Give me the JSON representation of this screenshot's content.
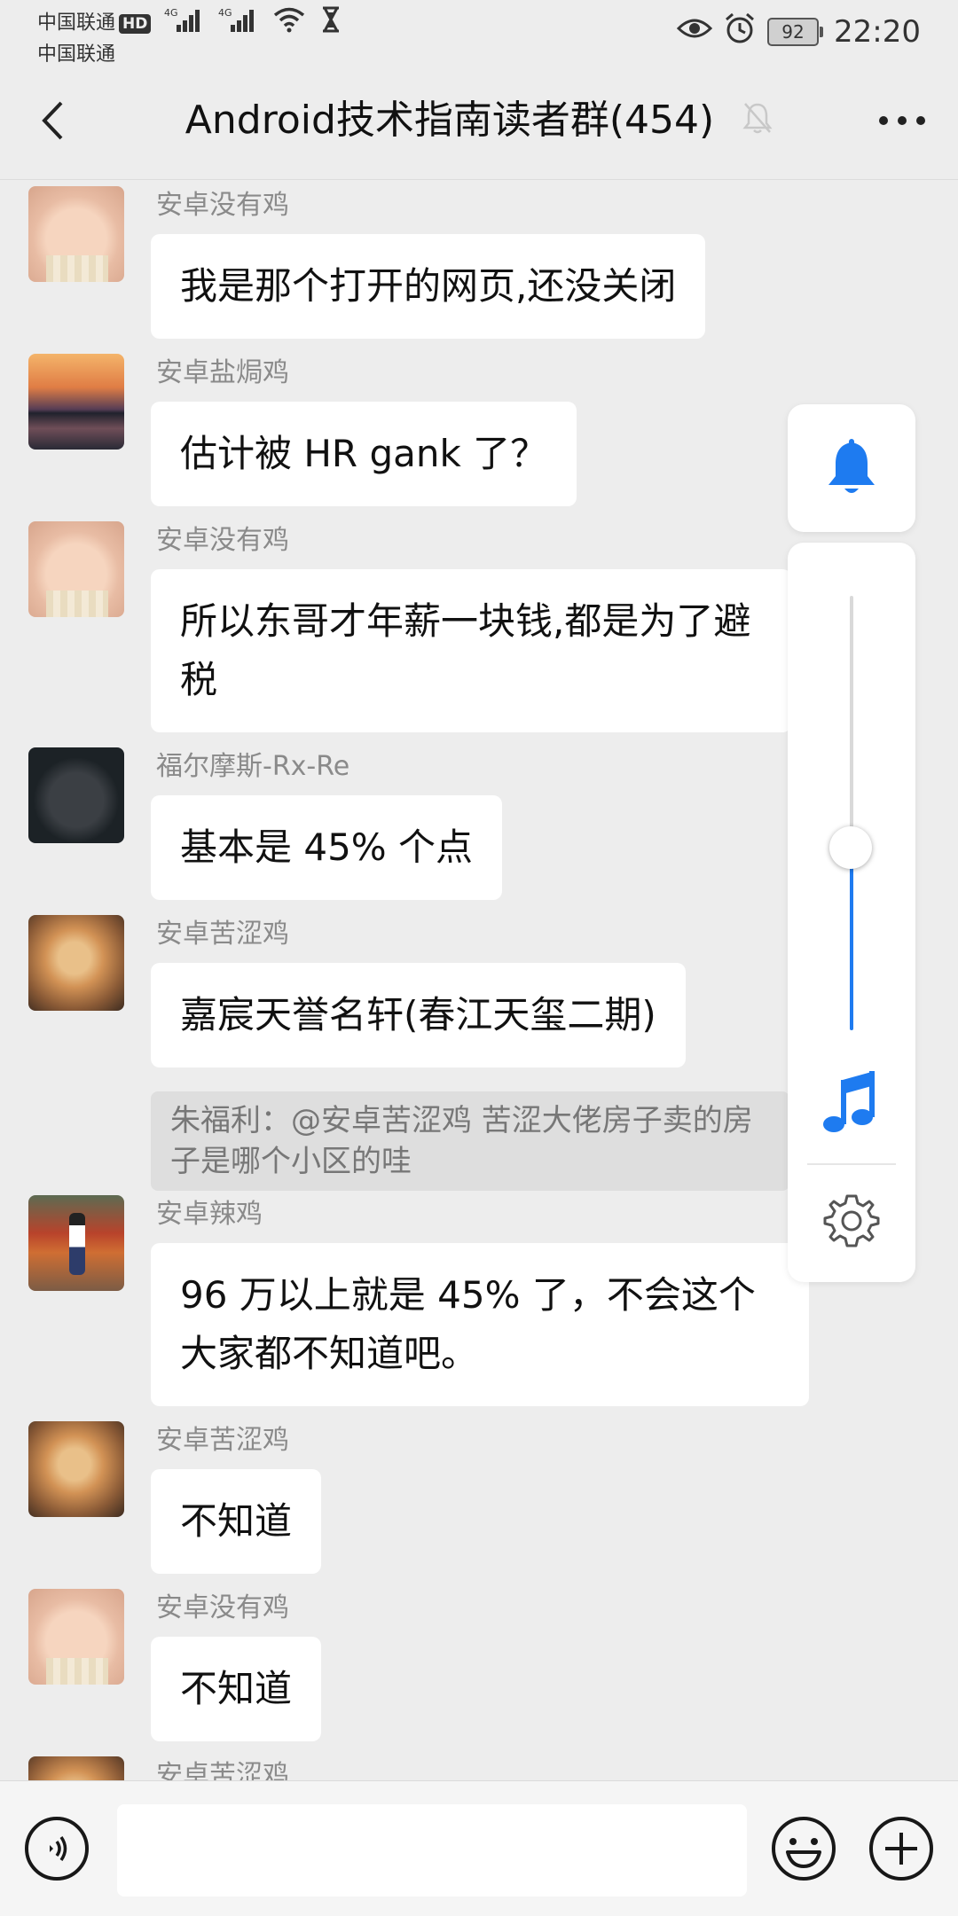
{
  "status_bar": {
    "carrier1": "中国联通",
    "carrier2": "中国联通",
    "hd_badge": "HD",
    "network1": "4G",
    "network2": "4G",
    "battery": "92",
    "time": "22:20"
  },
  "header": {
    "title": "Android技术指南读者群(454)"
  },
  "messages": [
    {
      "sender": "安卓没有鸡",
      "text": "我是那个打开的网页,还没关闭"
    },
    {
      "sender": "安卓盐焗鸡",
      "text": "估计被 HR gank 了？"
    },
    {
      "sender": "安卓没有鸡",
      "text": "所以东哥才年薪一块钱,都是为了避税"
    },
    {
      "sender": "福尔摩斯-Rx-Re",
      "text": "基本是 45% 个点"
    },
    {
      "sender": "安卓苦涩鸡",
      "text": "嘉宸天誉名轩(春江天玺二期)",
      "quote": "朱福利：@安卓苦涩鸡 苦涩大佬房子卖的房子是哪个小区的哇"
    },
    {
      "sender": "安卓辣鸡",
      "text": "96 万以上就是 45% 了，不会这个大家都不知道吧。"
    },
    {
      "sender": "安卓苦涩鸡",
      "text": "不知道"
    },
    {
      "sender": "安卓没有鸡",
      "text": "不知道"
    },
    {
      "sender": "安卓苦涩鸡",
      "text": ""
    }
  ],
  "volume_panel": {
    "level": 0.42,
    "accent_color": "#1e7bf0"
  },
  "input_bar": {
    "placeholder": ""
  },
  "icons": {
    "back": "back-arrow-icon",
    "mute": "bell-off-icon",
    "more": "more-icon",
    "ringer": "bell-icon",
    "music": "music-note-icon",
    "settings": "gear-icon",
    "voice": "voice-icon",
    "emoji": "emoji-icon",
    "plus": "plus-icon"
  }
}
